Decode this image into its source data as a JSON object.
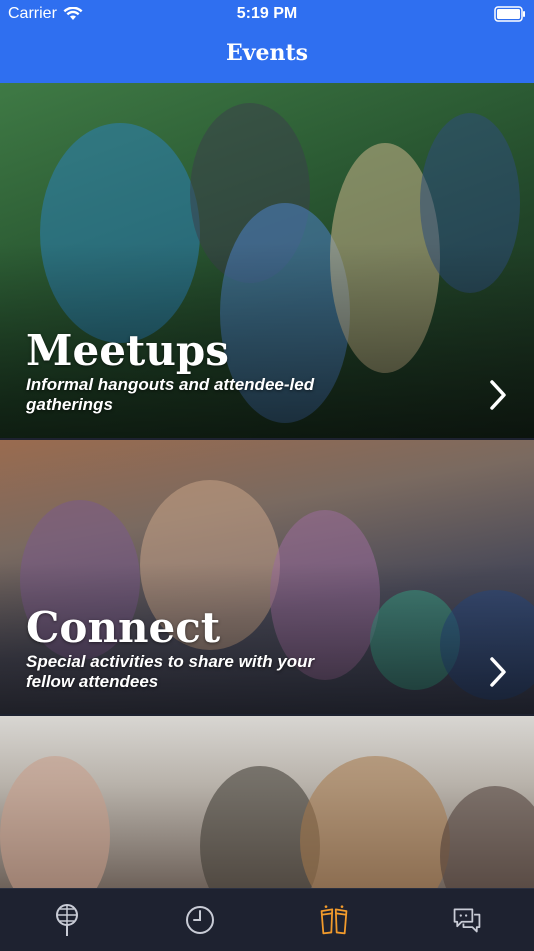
{
  "status_bar": {
    "carrier": "Carrier",
    "time": "5:19 PM"
  },
  "nav": {
    "title": "Events"
  },
  "cards": [
    {
      "title": "Meetups",
      "subtitle": "Informal hangouts and attendee-led gatherings"
    },
    {
      "title": "Connect",
      "subtitle": "Special activities to share with your fellow attendees"
    },
    {
      "title": "",
      "subtitle": ""
    }
  ],
  "tabbar": {
    "items": [
      {
        "icon": "globe-pin-icon",
        "active": false
      },
      {
        "icon": "clock-icon",
        "active": false
      },
      {
        "icon": "drinks-icon",
        "active": true
      },
      {
        "icon": "chat-bubbles-icon",
        "active": false
      }
    ],
    "colors": {
      "active": "#f29b2c",
      "inactive": "#c9ccd6"
    }
  },
  "colors": {
    "nav_bg": "#2f6ff0",
    "tabbar_bg": "#1e2230"
  }
}
